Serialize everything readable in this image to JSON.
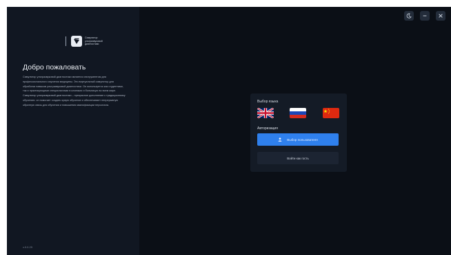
{
  "logo": {
    "text": "Симулятор ультразвуковой диагностики"
  },
  "welcome": {
    "title": "Добро пожаловать",
    "text": "Симулятор ультразвуковой диагностики является инструментом для профессионального изучения медицины. Это виртуальный симулятор для обработки навыков ультразвуковой диагностики. Он используется как студентами, так и практикующими специалистами в клиниках и больницах во всем мире. Симулятор ультразвуковой диагностики – прекрасное дополнение к традиционному обучению: он помогает создать яркую обучение и обеспечивает непрерывную обратную связь для обучения и повышения квалификации персонала."
  },
  "version": "v.0.0.29",
  "window_controls": {
    "icons": [
      "moon-icon",
      "minimize-icon",
      "close-icon"
    ]
  },
  "card": {
    "language_label": "Выбор языка",
    "languages": [
      {
        "icon": "uk-flag-icon"
      },
      {
        "icon": "russia-flag-icon"
      },
      {
        "icon": "china-flag-icon"
      }
    ],
    "auth_label": "Авторизация",
    "select_user_label": "Выбор пользователя",
    "guest_label": "Войти как гость"
  },
  "colors": {
    "background": "#0b0f16",
    "sidebar": "#111722",
    "card": "#141b26",
    "accent": "#2f80ed",
    "guest_button": "#1c2432"
  }
}
